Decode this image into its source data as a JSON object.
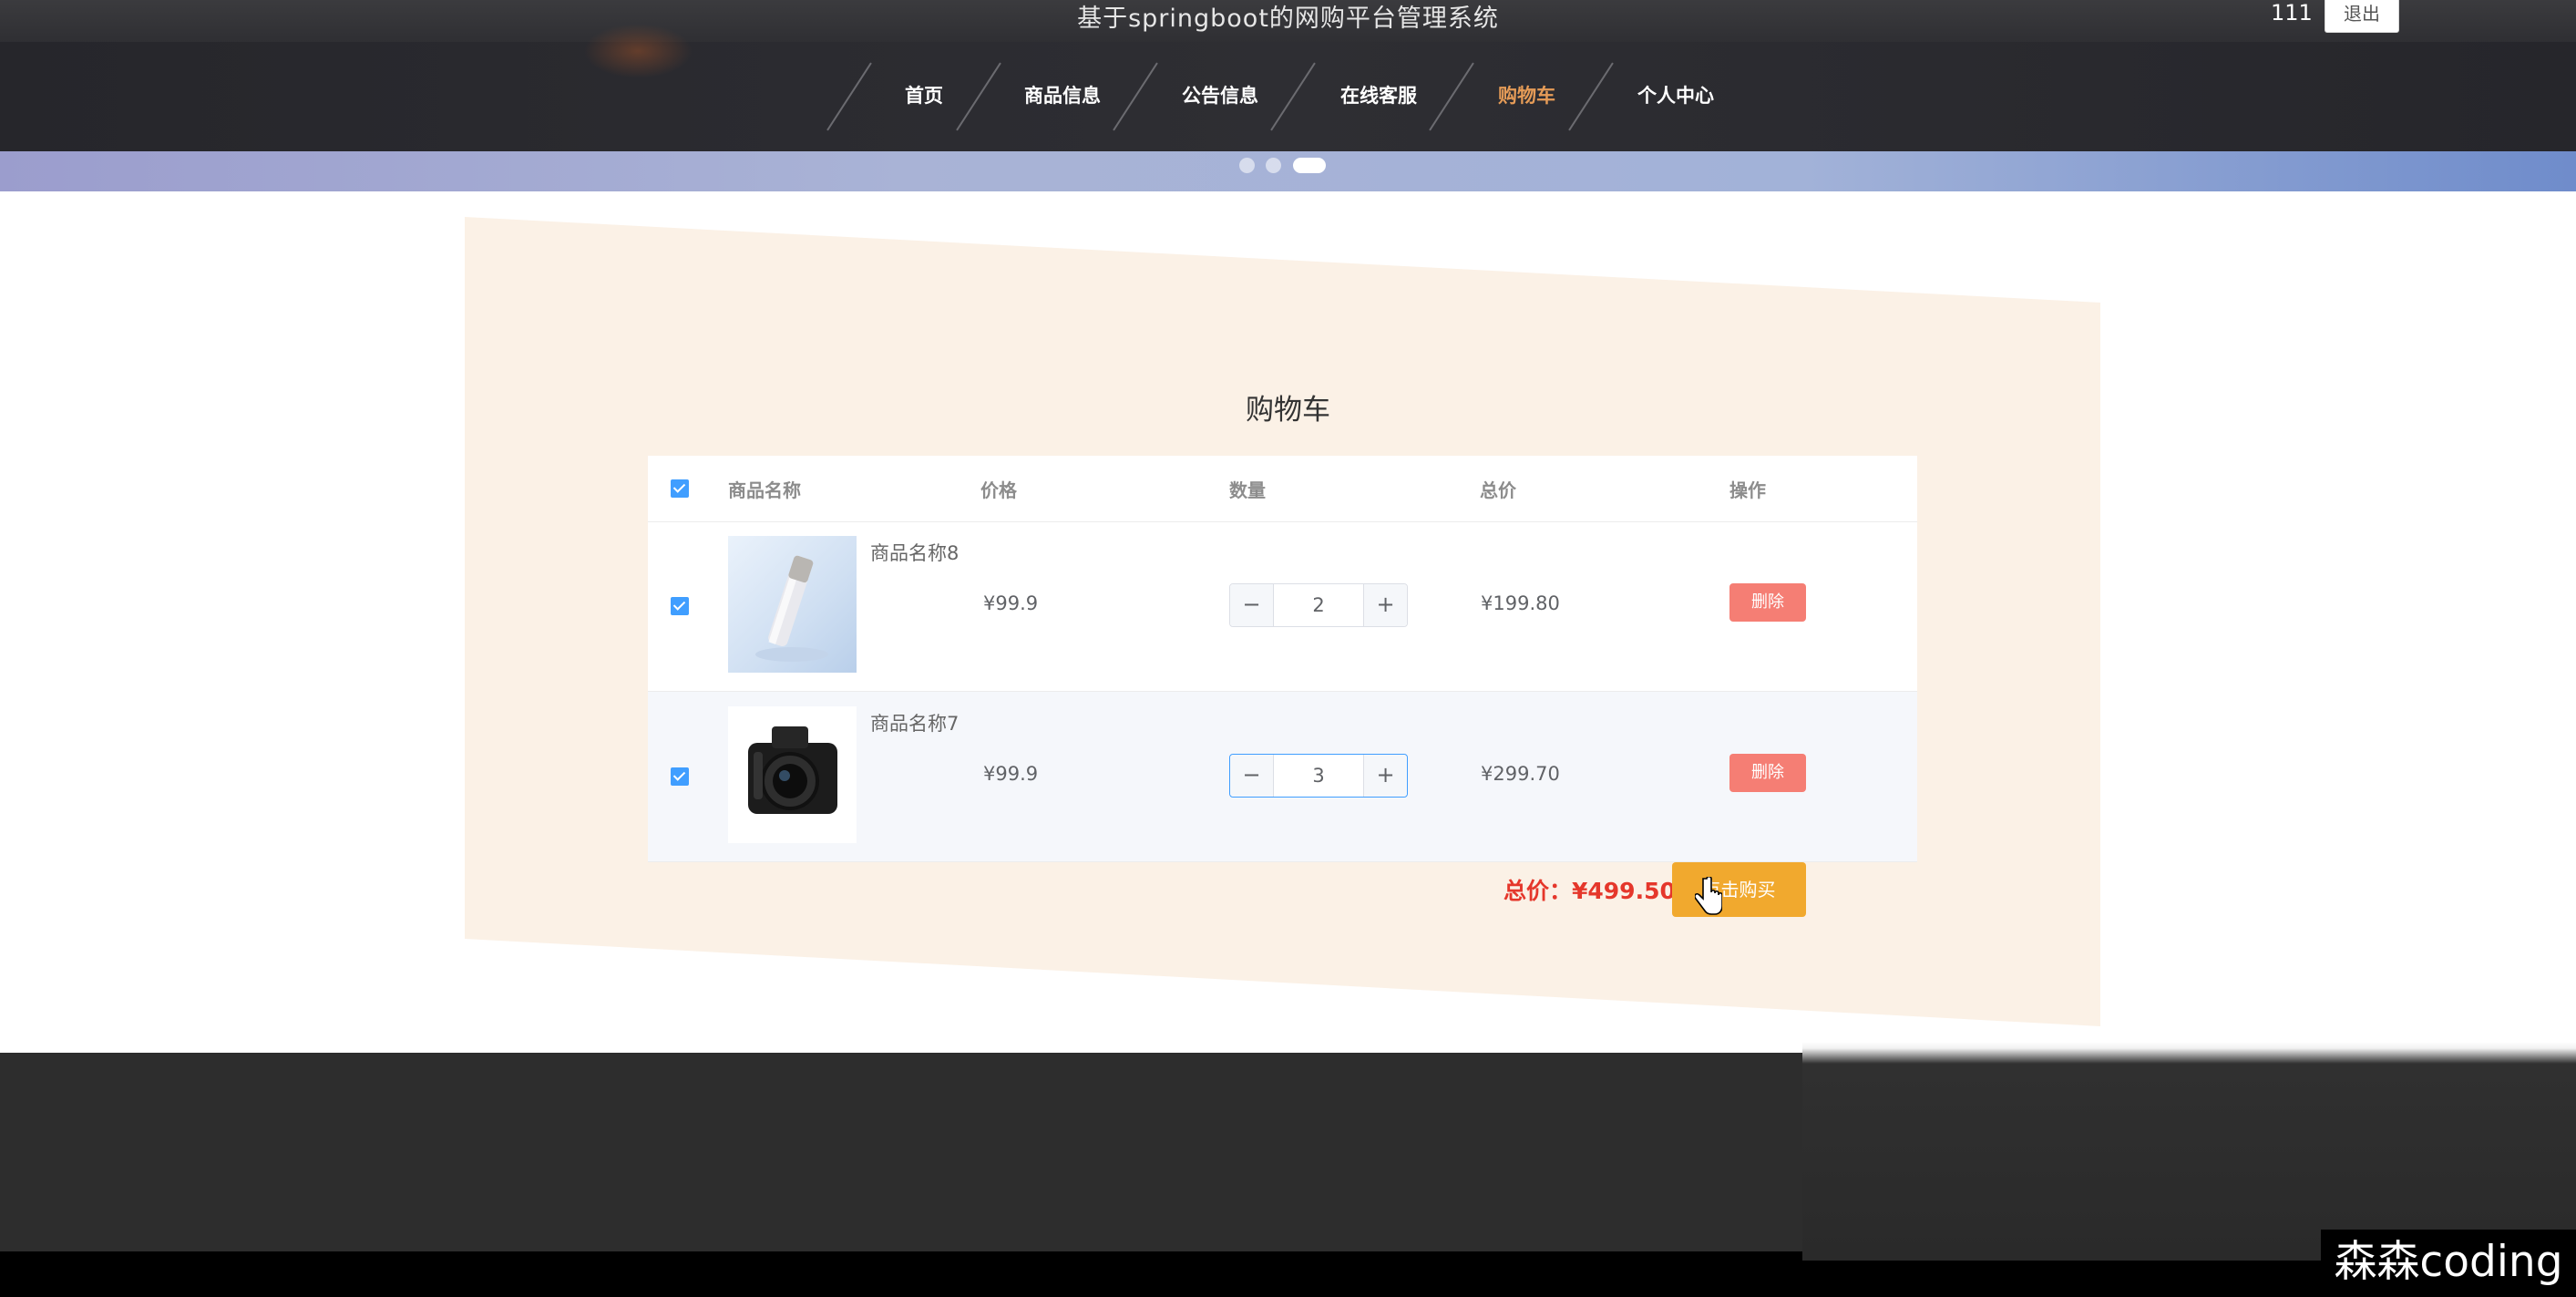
{
  "header": {
    "site_title": "基于springboot的网购平台管理系统",
    "username": "111",
    "logout_label": "退出"
  },
  "nav": {
    "items": [
      {
        "label": "首页",
        "active": false
      },
      {
        "label": "商品信息",
        "active": false
      },
      {
        "label": "公告信息",
        "active": false
      },
      {
        "label": "在线客服",
        "active": false
      },
      {
        "label": "购物车",
        "active": true
      },
      {
        "label": "个人中心",
        "active": false
      }
    ],
    "active_color": "#e59b57"
  },
  "carousel": {
    "slide_count": 3,
    "active_index": 2
  },
  "cart": {
    "title": "购物车",
    "columns": [
      "商品名称",
      "价格",
      "数量",
      "总价",
      "操作"
    ],
    "rows": [
      {
        "checked": true,
        "name": "商品名称8",
        "price": "¥99.9",
        "quantity": "2",
        "subtotal": "¥199.80",
        "delete_label": "删除",
        "image_icon": "bottle-product-image"
      },
      {
        "checked": true,
        "name": "商品名称7",
        "price": "¥99.9",
        "quantity": "3",
        "subtotal": "¥299.70",
        "delete_label": "删除",
        "image_icon": "camera-product-image"
      }
    ],
    "total_label": "总价：¥499.50",
    "buy_label": "点击购买",
    "colors": {
      "checkbox": "#409eff",
      "delete": "#f57e74",
      "buy": "#f1a92e",
      "total": "#e5372b"
    }
  },
  "watermark": "森森coding"
}
